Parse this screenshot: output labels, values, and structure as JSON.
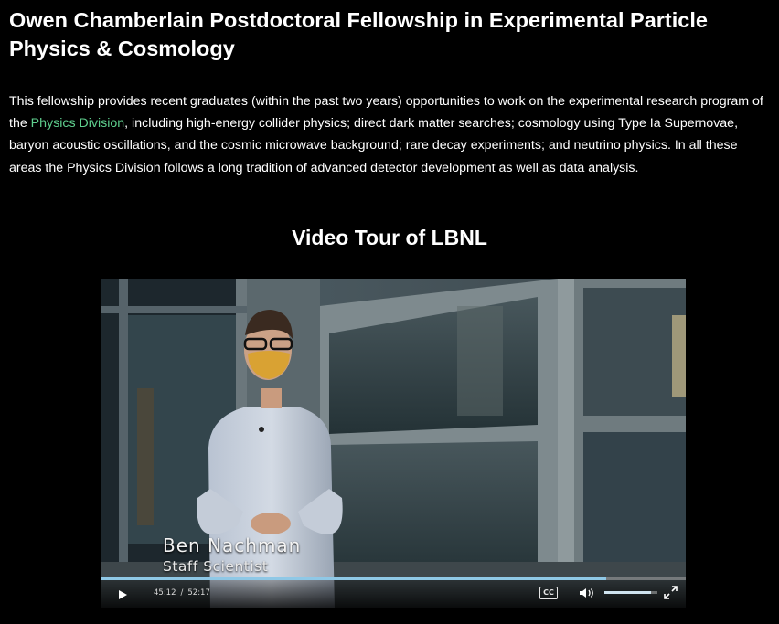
{
  "page": {
    "title": "Owen Chamberlain Postdoctoral Fellowship in Experimental Particle Physics & Cosmology",
    "intro": {
      "before_link": "This fellowship provides recent graduates (within the past two years) opportunities to work on the experimental research program of the ",
      "link_text": "Physics Division",
      "after_link": ", including high-energy collider physics; direct dark matter searches; cosmology using Type Ia Supernovae, baryon acoustic oscillations, and the cosmic microwave background; rare decay experiments; and neutrino physics. In all these areas the Physics Division follows a long tradition of advanced detector development as well as data analysis."
    },
    "video_heading": "Video Tour of LBNL"
  },
  "video": {
    "caption_name": "Ben Nachman",
    "caption_role": "Staff Scientist",
    "current_time": "45:12",
    "duration": "52:17",
    "progress_fraction": 0.864,
    "volume_fraction": 0.88,
    "cc_label": "CC",
    "icons": {
      "play": "play-icon",
      "volume": "volume-icon",
      "fullscreen": "fullscreen-icon"
    }
  },
  "colors": {
    "background": "#000000",
    "text": "#ffffff",
    "link": "#5fcf8e",
    "progress": "#8fc8e6"
  }
}
